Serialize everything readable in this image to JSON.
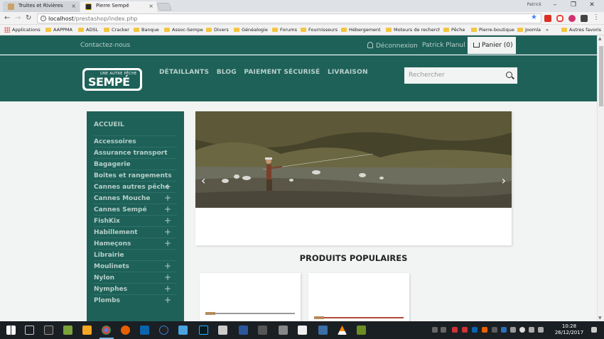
{
  "browser": {
    "tabs": [
      {
        "title": "Truites et Rivières",
        "active": false
      },
      {
        "title": "Pierre Sempé",
        "active": true
      }
    ],
    "profile_name": "Patrick",
    "url_host": "localhost",
    "url_path": "/prestashop/index.php",
    "bookmarks": [
      "Applications",
      "AAPPMA",
      "ADSL",
      "Cracker",
      "Banque",
      "Assoc-Sempe",
      "Divers",
      "Généalogie",
      "Forums",
      "Fournisseurs",
      "Hébergement",
      "Moteurs de recherche",
      "Pêche",
      "Pierre-boutique",
      "Joomla"
    ],
    "bookmarks_overflow": "»",
    "other_bookmarks": "Autres favoris",
    "accent_color": "#4285f4"
  },
  "site": {
    "brand_color": "#1e6159",
    "topbar": {
      "contact": "Contactez-nous",
      "logout": "Déconnexion",
      "username": "Patrick Planul",
      "cart": "Panier (0)"
    },
    "logo": {
      "tagline": "UNE AUTRE PÊCHE",
      "name": "SEMPÉ"
    },
    "nav": [
      "DÉTAILLANTS",
      "BLOG",
      "PAIEMENT SÉCURISÉ",
      "LIVRAISON"
    ],
    "search_placeholder": "Rechercher",
    "sidebar": {
      "home": "ACCUEIL",
      "categories": [
        {
          "label": "Accessoires",
          "expandable": false
        },
        {
          "label": "Assurance transport",
          "expandable": false
        },
        {
          "label": "Bagagerie",
          "expandable": false
        },
        {
          "label": "Boites et rangements",
          "expandable": false
        },
        {
          "label": "Cannes autres pêche",
          "expandable": true
        },
        {
          "label": "Cannes Mouche",
          "expandable": true
        },
        {
          "label": "Cannes Sempé",
          "expandable": true
        },
        {
          "label": "FishKix",
          "expandable": true
        },
        {
          "label": "Habillement",
          "expandable": true
        },
        {
          "label": "Hameçons",
          "expandable": true
        },
        {
          "label": "Librairie",
          "expandable": false
        },
        {
          "label": "Moulinets",
          "expandable": true
        },
        {
          "label": "Nylon",
          "expandable": true
        },
        {
          "label": "Nymphes",
          "expandable": true
        },
        {
          "label": "Plombs",
          "expandable": true
        }
      ]
    },
    "slider": {
      "prev": "‹",
      "next": "›"
    },
    "popular_title": "PRODUITS POPULAIRES"
  },
  "taskbar": {
    "time": "10:28",
    "date": "26/12/2017"
  }
}
